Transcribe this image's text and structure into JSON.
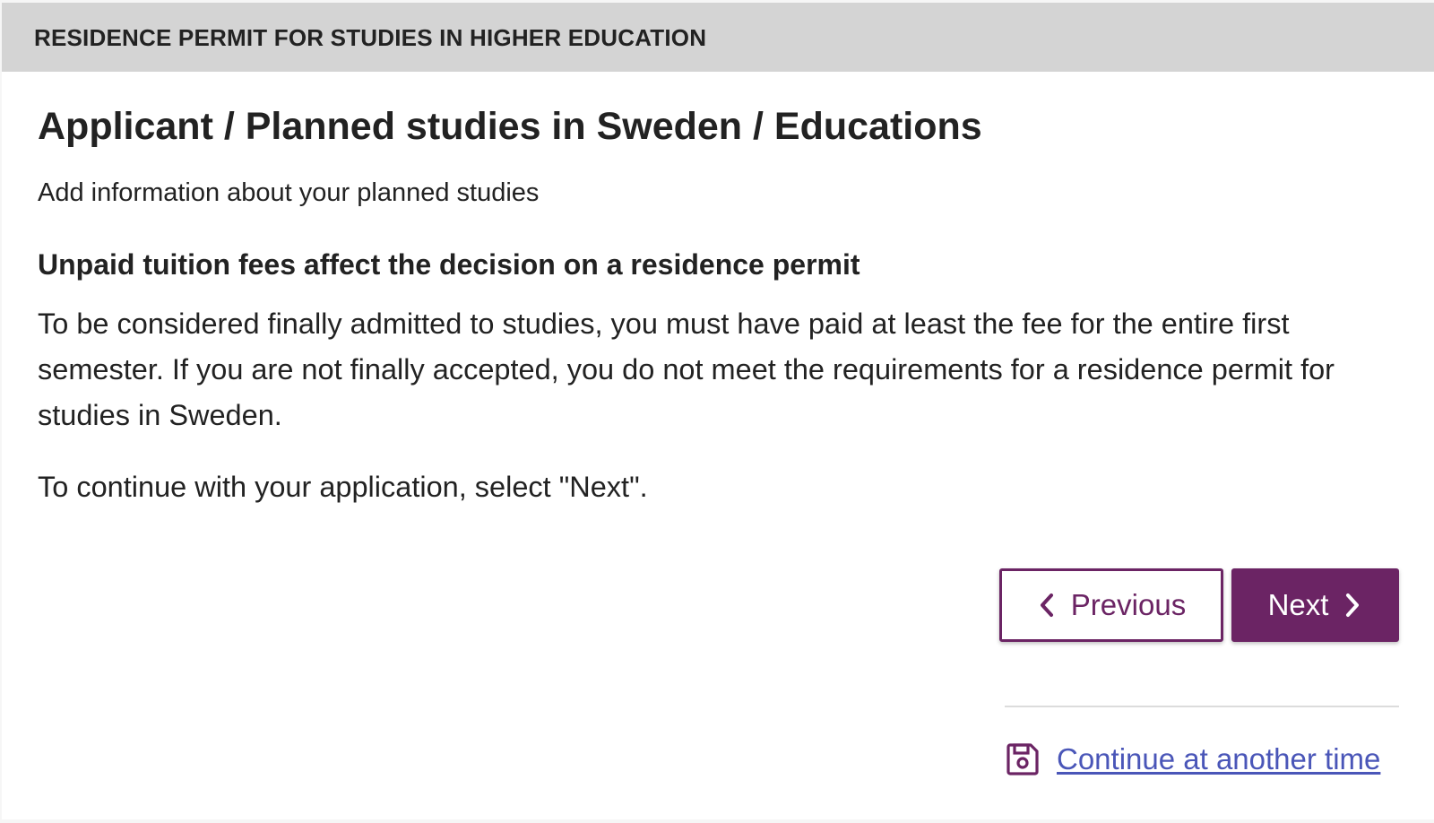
{
  "header": {
    "title": "RESIDENCE PERMIT FOR STUDIES IN HIGHER EDUCATION"
  },
  "main": {
    "title": "Applicant / Planned studies in Sweden / Educations",
    "subtitle": "Add information about your planned studies",
    "notice_heading": "Unpaid tuition fees affect the decision on a residence permit",
    "notice_body": "To be considered finally admitted to studies, you must have paid at least the fee for the entire first semester. If you are not finally accepted, you do not meet the requirements for a residence permit for studies in Sweden.",
    "continue_hint": "To continue with your application, select \"Next\"."
  },
  "navigation": {
    "previous_label": "Previous",
    "next_label": "Next",
    "previous_icon": "chevron-left-icon",
    "next_icon": "chevron-right-icon"
  },
  "footer": {
    "save_link_label": "Continue at another time",
    "save_icon": "floppy-disk-icon"
  },
  "colors": {
    "brand_purple": "#6b2464",
    "header_background": "#d4d4d4",
    "link_blue": "#4a56b8",
    "text": "#222222"
  }
}
